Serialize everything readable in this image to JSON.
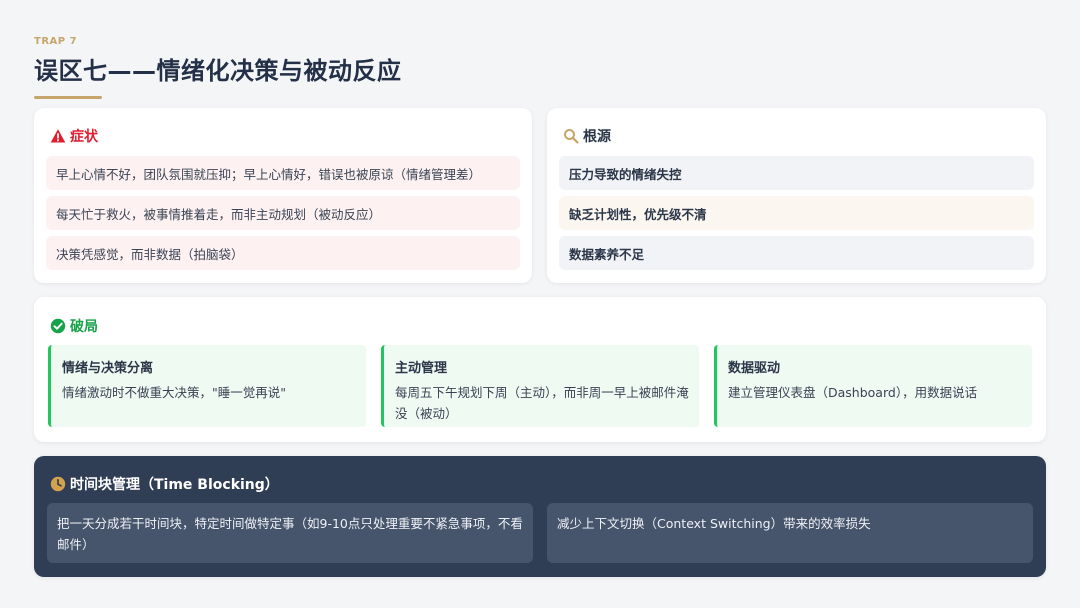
{
  "header": {
    "eyebrow": "TRAP 7",
    "title": "误区七——情绪化决策与被动反应"
  },
  "symptoms": {
    "heading": "症状",
    "icon": "warning-icon",
    "accent": "#e11d2e",
    "items": [
      "早上心情不好，团队氛围就压抑；早上心情好，错误也被原谅（情绪管理差）",
      "每天忙于救火，被事情推着走，而非主动规划（被动反应）",
      "决策凭感觉，而非数据（拍脑袋）"
    ]
  },
  "roots": {
    "heading": "根源",
    "icon": "search-icon",
    "accent": "#c6a56a",
    "items": [
      "压力导致的情绪失控",
      "缺乏计划性，优先级不清",
      "数据素养不足"
    ]
  },
  "breakthrough": {
    "heading": "破局",
    "icon": "check-circle-icon",
    "accent": "#16a34a",
    "items": [
      {
        "title": "情绪与决策分离",
        "desc": "情绪激动时不做重大决策，\"睡一觉再说\""
      },
      {
        "title": "主动管理",
        "desc": "每周五下午规划下周（主动），而非周一早上被邮件淹没（被动）"
      },
      {
        "title": "数据驱动",
        "desc": "建立管理仪表盘（Dashboard），用数据说话"
      }
    ]
  },
  "timeblock": {
    "heading": "时间块管理（Time Blocking）",
    "icon": "clock-icon",
    "accent": "#d4a24c",
    "items": [
      "把一天分成若干时间块，特定时间做特定事（如9-10点只处理重要不紧急事项，不看邮件）",
      "减少上下文切换（Context Switching）带来的效率损失"
    ]
  }
}
